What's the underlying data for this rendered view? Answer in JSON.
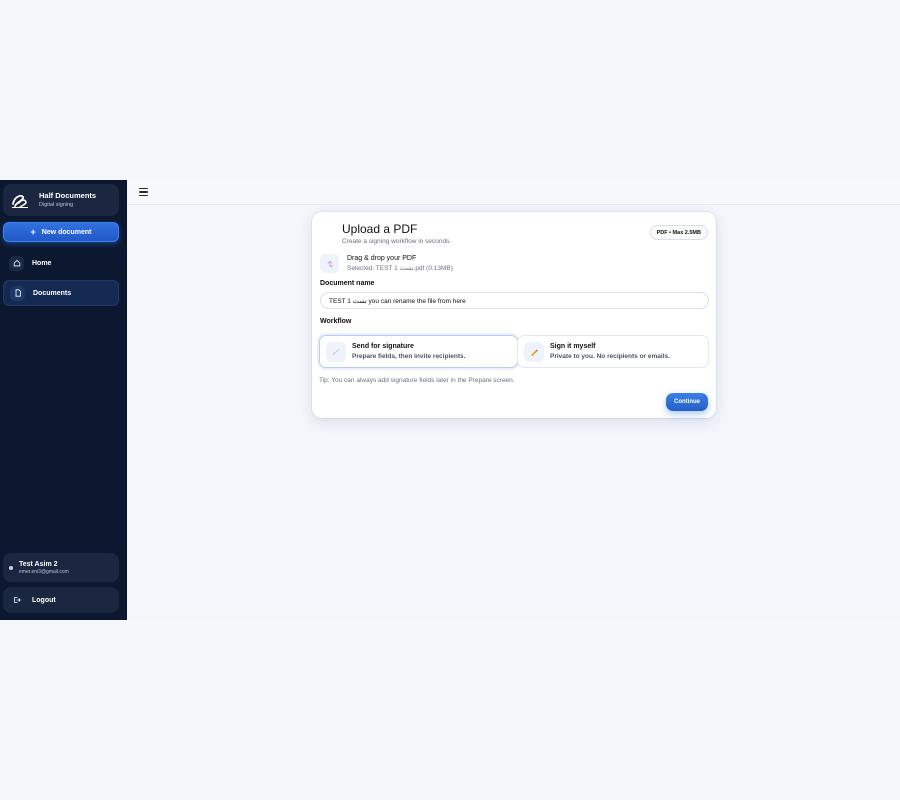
{
  "sidebar": {
    "brand": {
      "title": "Half Documents",
      "subtitle": "Digital signing"
    },
    "new_document_label": "New document",
    "nav": [
      {
        "label": "Home",
        "icon": "home-icon"
      },
      {
        "label": "Documents",
        "icon": "document-icon",
        "active": true
      }
    ],
    "user": {
      "name": "Test Asim 2",
      "email": "emer.eni3@gmail.com"
    },
    "logout_label": "Logout"
  },
  "upload_card": {
    "title": "Upload a PDF",
    "subtitle": "Create a signing workflow in seconds.",
    "badge": "PDF • Max 2.5MB",
    "dropzone": {
      "title": "Drag & drop your PDF",
      "selected": "Selected: TEST 1 تست.pdf (0.13MB)"
    },
    "document_name_label": "Document name",
    "document_name_value": "TEST 1 تست you can rename the file from here",
    "workflow_label": "Workflow",
    "workflow_options": [
      {
        "title": "Send for signature",
        "description": "Prepare fields, then invite recipients.",
        "selected": true
      },
      {
        "title": "Sign it myself",
        "description": "Private to you. No recipients or emails.",
        "selected": false
      }
    ],
    "tip": "Tip: You can always add signature fields later in the Prepare screen.",
    "continue_label": "Continue"
  },
  "colors": {
    "sidebar_bg": "#0c1830",
    "accent": "#2f72e0",
    "page_bg": "#f3f6fb"
  }
}
